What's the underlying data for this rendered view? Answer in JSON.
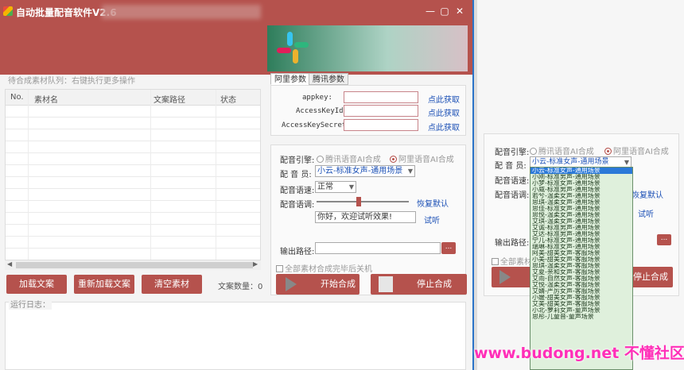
{
  "window": {
    "title": "自动批量配音软件V2.6",
    "minimize": "—",
    "maximize": "▢",
    "close": "✕"
  },
  "queue": {
    "hint": "待合成素材队列：右键执行更多操作",
    "columns": [
      "No.",
      "素材名",
      "文案路径",
      "状态"
    ],
    "buttons": {
      "load": "加载文案",
      "reload": "重新加载文案",
      "clear": "清空素材"
    },
    "count_label": "文案数量：0"
  },
  "params": {
    "tabs": [
      "阿里参数",
      "腾讯参数"
    ],
    "fields": [
      {
        "label": "appkey:",
        "action": "点此获取"
      },
      {
        "label": "AccessKeyId:",
        "action": "点此获取"
      },
      {
        "label": "AccessKeySecret:",
        "action": "点此获取"
      }
    ]
  },
  "voice": {
    "engine_label": "配音引擎:",
    "engine_options": [
      "腾讯语音AI合成",
      "阿里语音AI合成"
    ],
    "engine_selected": 1,
    "speaker_label": "配 音 员:",
    "speaker_value": "小云-标准女声-通用场景",
    "speed_label": "配音语速:",
    "speed_value": "正常",
    "tone_label": "配音语调:",
    "reset": "恢复默认",
    "sample_text": "你好，欢迎试听效果!",
    "preview": "试听",
    "output_label": "输出路径:",
    "browse": "...",
    "shutdown": "全部素材合成完毕后关机",
    "start": "开始合成",
    "stop": "停止合成"
  },
  "log": {
    "title": "运行日志："
  },
  "zoom": {
    "engine_label": "配音引擎:",
    "engine_options": [
      "腾讯语音AI合成",
      "阿里语音AI合成"
    ],
    "speaker_label": "配 音 员:",
    "speaker_value": "小云-标准女声-通用场景",
    "speed_label": "配音语速:",
    "tone_label": "配音语调:",
    "reset": "恢复默认",
    "preview": "试听",
    "output_label": "输出路径:",
    "browse": "...",
    "shutdown": "全部素材",
    "stop": "停止合成",
    "list": [
      "小云-标准女声-通用场景",
      "小刚-标准男声-通用场景",
      "小梦-标准女声-通用场景",
      "小威-标准男声-通用场景",
      "若兮-温柔女声-通用场景",
      "思琪-温柔女声-通用场景",
      "思佳-标准女声-通用场景",
      "思悦-温柔女声-通用场景",
      "艾琪-温柔女声-通用场景",
      "艾诚-标准男声-通用场景",
      "艾达-标准男声-通用场景",
      "宁儿-标准女声-通用场景",
      "瑞琳-标准女声-通用场景",
      "阿美-甜美女声-客服场景",
      "小美-甜美女声-客服场景",
      "思琪-温柔女声-客服场景",
      "艾夏-亲和女声-客服场景",
      "艾雨-自然女声-客服场景",
      "艾悦-温柔女声-客服场景",
      "艾婧-严厉女声-客服场景",
      "小媛-甜美女声-客服场景",
      "艾美-甜美女声-客服场景",
      "小北-萝莉女声-童声场景",
      "思彤-儿童音-童声场景"
    ]
  },
  "watermark": "www.budong.net 不懂社区"
}
